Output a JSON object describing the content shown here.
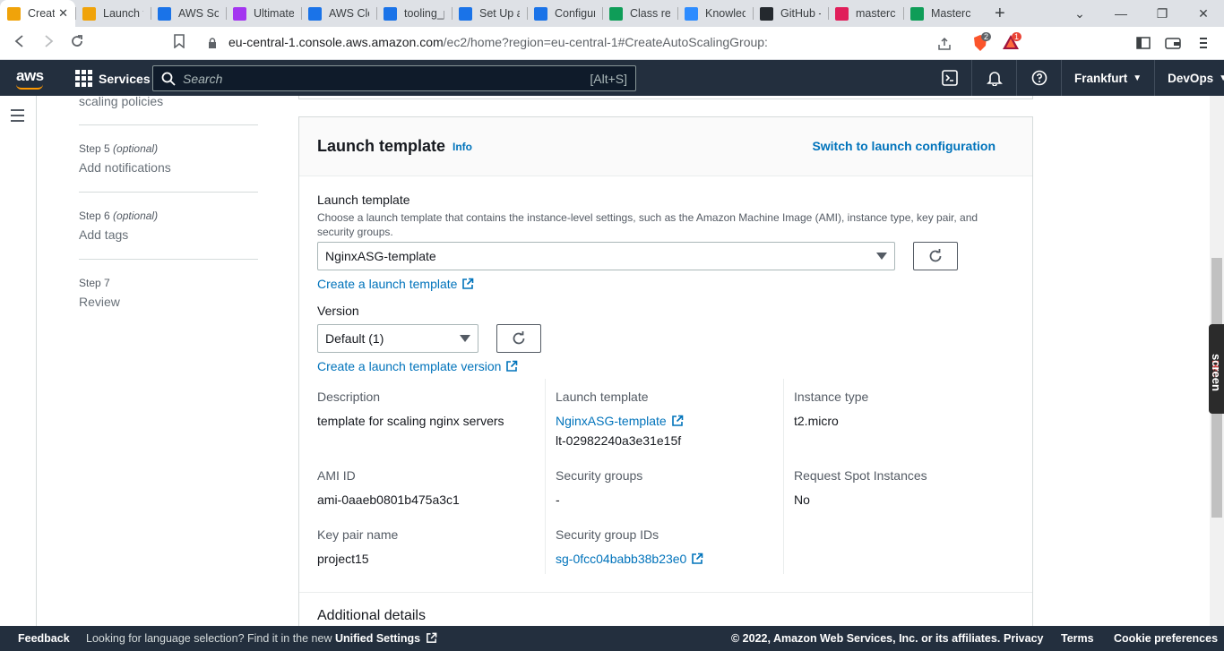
{
  "browser": {
    "tabs": [
      {
        "title": "Creat",
        "icon": "aws-box-icon",
        "color": "#f0a30a",
        "active": true
      },
      {
        "title": "Launch te",
        "icon": "aws-box-icon",
        "color": "#f0a30a"
      },
      {
        "title": "AWS Sol",
        "icon": "blog-icon",
        "color": "#1a73e8"
      },
      {
        "title": "Ultimate",
        "icon": "udemy-icon",
        "color": "#a435f0"
      },
      {
        "title": "AWS Clo",
        "icon": "blog-icon",
        "color": "#1a73e8"
      },
      {
        "title": "tooling_p",
        "icon": "blog-icon",
        "color": "#1a73e8"
      },
      {
        "title": "Set Up a",
        "icon": "blog-icon",
        "color": "#1a73e8"
      },
      {
        "title": "Configur",
        "icon": "blog-icon",
        "color": "#1a73e8"
      },
      {
        "title": "Class rec",
        "icon": "sheets-icon",
        "color": "#0f9d58"
      },
      {
        "title": "Knowled",
        "icon": "zoom-icon",
        "color": "#2d8cff"
      },
      {
        "title": "GitHub -",
        "icon": "github-icon",
        "color": "#24292e"
      },
      {
        "title": "mastercl",
        "icon": "slack-icon",
        "color": "#e01e5a"
      },
      {
        "title": "Mastercl",
        "icon": "sheets-icon",
        "color": "#0f9d58"
      }
    ],
    "url_host": "eu-central-1.console.aws.amazon.com",
    "url_rest": "/ec2/home?region=eu-central-1#CreateAutoScalingGroup:",
    "brave_badge": "2",
    "alert_badge": "1"
  },
  "awsnav": {
    "logo": "aws",
    "services": "Services",
    "search_placeholder": "Search",
    "search_shortcut": "[Alt+S]",
    "region": "Frankfurt",
    "account": "DevOps"
  },
  "steps": {
    "cont": "scaling policies",
    "items": [
      {
        "label": "Step 5",
        "optional": "(optional)",
        "name": "Add notifications"
      },
      {
        "label": "Step 6",
        "optional": "(optional)",
        "name": "Add tags"
      },
      {
        "label": "Step 7",
        "optional": "",
        "name": "Review"
      }
    ]
  },
  "panel": {
    "title": "Launch template",
    "info": "Info",
    "switch": "Switch to launch configuration",
    "lt_label": "Launch template",
    "lt_desc": "Choose a launch template that contains the instance-level settings, such as the Amazon Machine Image (AMI), instance type, key pair, and security groups.",
    "lt_value": "NginxASG-template",
    "create_lt": "Create a launch template",
    "version_label": "Version",
    "version_value": "Default (1)",
    "create_version": "Create a launch template version",
    "details": {
      "description_k": "Description",
      "description_v": "template for scaling nginx servers",
      "lt_k": "Launch template",
      "lt_v": "NginxASG-template",
      "lt_id": "lt-02982240a3e31e15f",
      "instance_k": "Instance type",
      "instance_v": "t2.micro",
      "ami_k": "AMI ID",
      "ami_v": "ami-0aaeb0801b475a3c1",
      "sg_k": "Security groups",
      "sg_v": "-",
      "spot_k": "Request Spot Instances",
      "spot_v": "No",
      "key_k": "Key pair name",
      "key_v": "project15",
      "sgid_k": "Security group IDs",
      "sgid_v": "sg-0fcc04babb38b23e0"
    },
    "additional": "Additional details"
  },
  "footer": {
    "feedback": "Feedback",
    "lang": "Looking for language selection? Find it in the new",
    "unified": "Unified Settings",
    "copy": "© 2022, Amazon Web Services, Inc. or its affiliates.",
    "privacy": "Privacy",
    "terms": "Terms",
    "cookie": "Cookie preferences"
  },
  "screenrec": {
    "a": "screen",
    "b": "rec"
  }
}
